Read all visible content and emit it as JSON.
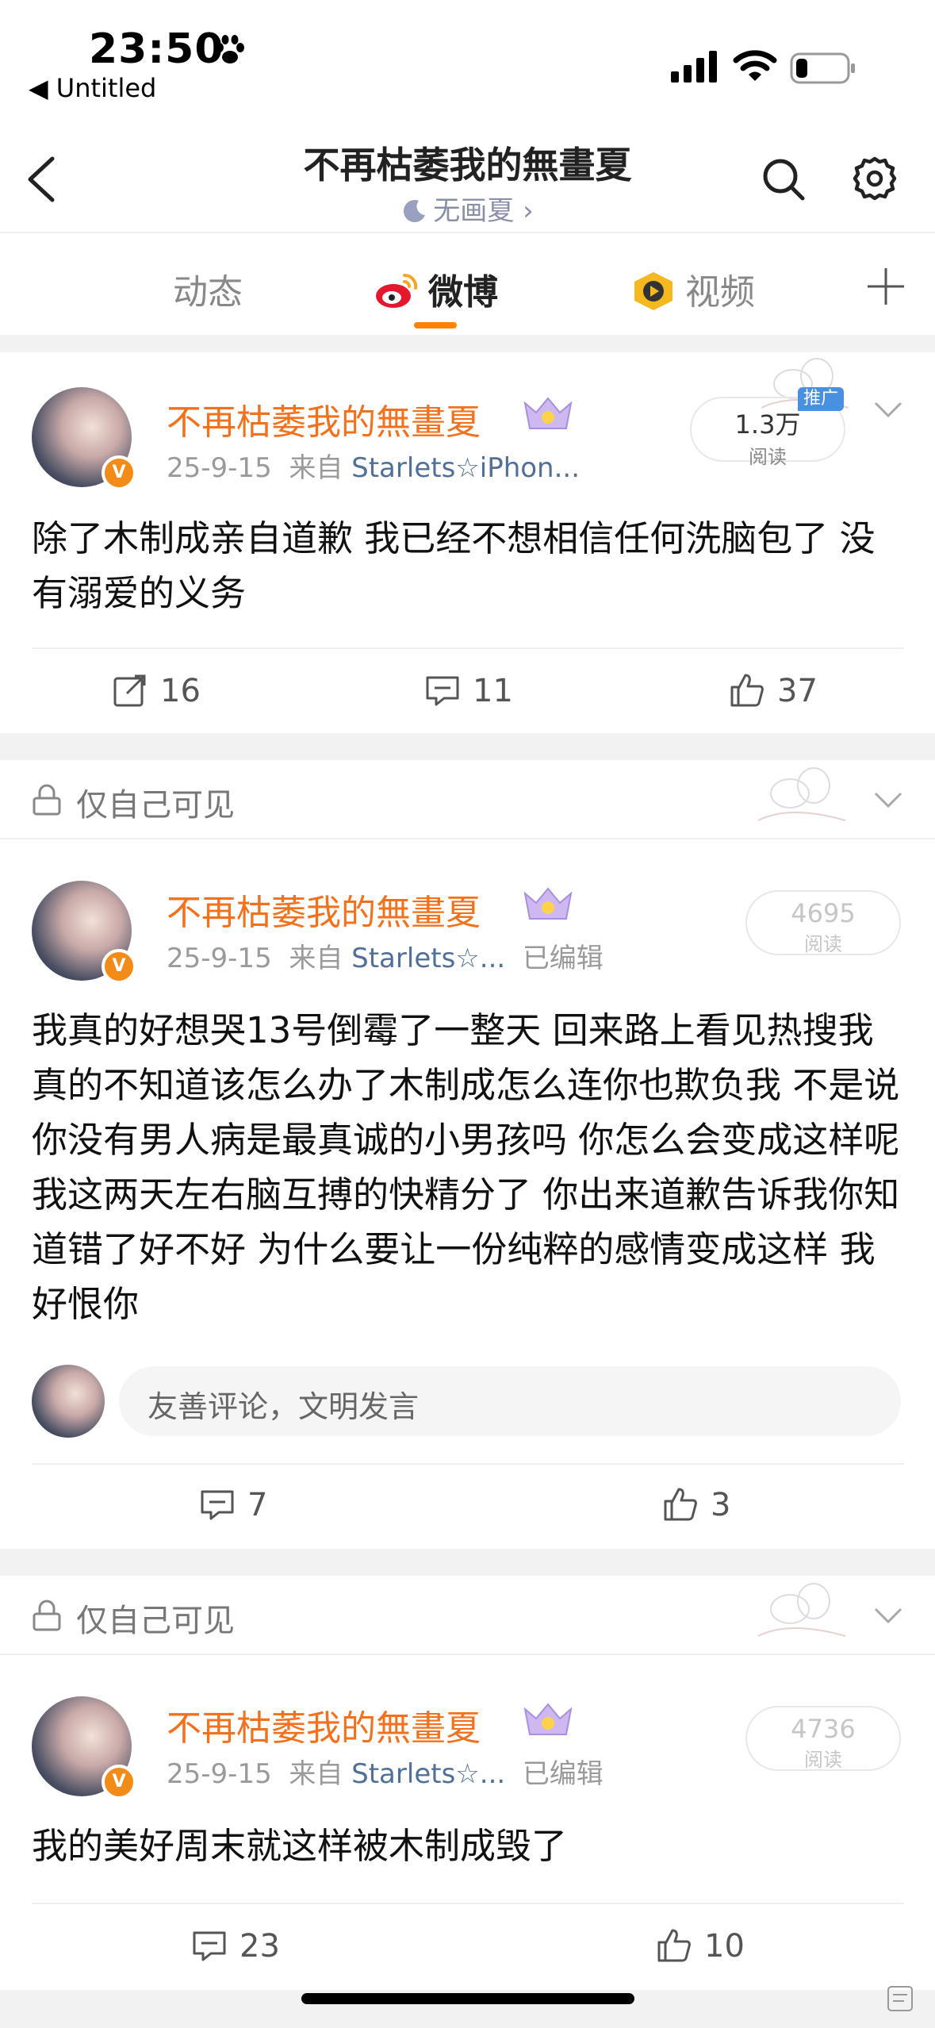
{
  "status_bar": {
    "time": "23:50",
    "back_app": "◀ Untitled"
  },
  "header": {
    "title": "不再枯萎我的無畫夏",
    "subtitle": "无画夏 ›"
  },
  "tabs": [
    {
      "label": "动态",
      "active": false
    },
    {
      "label": "微博",
      "active": true
    },
    {
      "label": "视频",
      "active": false
    }
  ],
  "posts": [
    {
      "username": "不再枯萎我的無畫夏",
      "date": "25-9-15",
      "source_prefix": "来自",
      "source": "Starlets☆iPhon...",
      "edited": "",
      "reads": "1.3万",
      "reads_label": "阅读",
      "promo": "推广",
      "text": "除了木制成亲自道歉 我已经不想相信任何洗脑包了 没有溺爱的义务",
      "repost": "16",
      "comments": "11",
      "likes": "37"
    },
    {
      "private_label": "仅自己可见",
      "username": "不再枯萎我的無畫夏",
      "date": "25-9-15",
      "source_prefix": "来自",
      "source": "Starlets☆...",
      "edited": "已编辑",
      "reads": "4695",
      "reads_label": "阅读",
      "text": "我真的好想哭13号倒霉了一整天 回来路上看见热搜我真的不知道该怎么办了木制成怎么连你也欺负我 不是说你没有男人病是最真诚的小男孩吗 你怎么会变成这样呢 我这两天左右脑互搏的快精分了 你出来道歉告诉我你知道错了好不好 为什么要让一份纯粹的感情变成这样 我好恨你",
      "comment_placeholder": "友善评论，文明发言",
      "comments": "7",
      "likes": "3"
    },
    {
      "private_label": "仅自己可见",
      "username": "不再枯萎我的無畫夏",
      "date": "25-9-15",
      "source_prefix": "来自",
      "source": "Starlets☆...",
      "edited": "已编辑",
      "reads": "4736",
      "reads_label": "阅读",
      "text": "我的美好周末就这样被木制成毁了",
      "comments": "23",
      "likes": "10"
    }
  ],
  "colors": {
    "accent": "#ff8200",
    "username": "#f3711d",
    "source": "#50709a",
    "promo": "#4a90e2"
  }
}
